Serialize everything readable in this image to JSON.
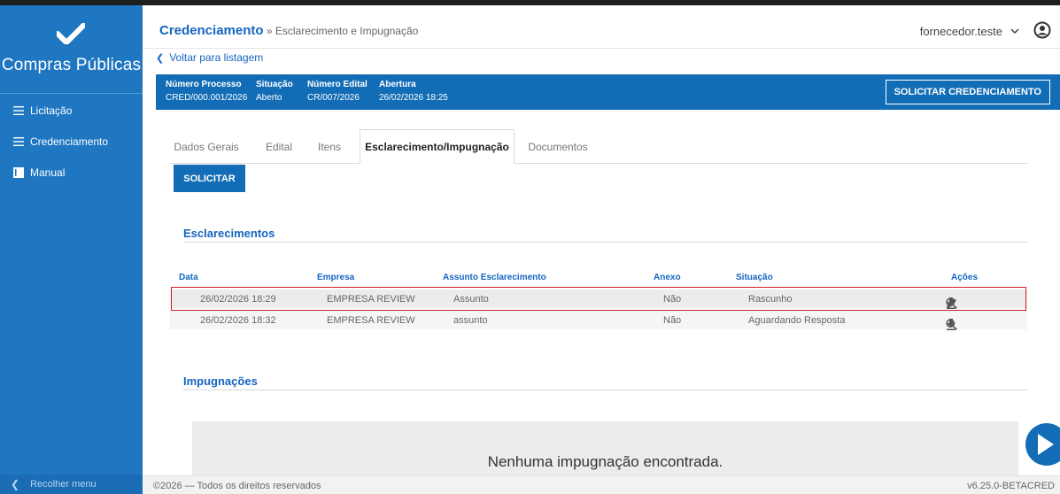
{
  "sidebar": {
    "brand": "Compras Públicas",
    "items": [
      {
        "label": "Licitação"
      },
      {
        "label": "Credenciamento"
      },
      {
        "label": "Manual"
      }
    ],
    "collapse_label": "Recolher menu"
  },
  "header": {
    "title": "Credenciamento",
    "breadcrumb": " » Esclarecimento e Impugnação",
    "user": "fornecedor.teste"
  },
  "back_link": "Voltar para listagem",
  "process": {
    "numero_processo_label": "Número Processo",
    "numero_processo": "CRED/000.001/2026",
    "situacao_label": "Situação",
    "situacao": "Aberto",
    "numero_edital_label": "Número Edital",
    "numero_edital": "CR/007/2026",
    "abertura_label": "Abertura",
    "abertura": "26/02/2026 18:25",
    "solicitar_credenciamento": "SOLICITAR CREDENCIAMENTO"
  },
  "tabs": [
    {
      "label": "Dados Gerais"
    },
    {
      "label": "Edital"
    },
    {
      "label": "Itens"
    },
    {
      "label": "Esclarecimento/Impugnação"
    },
    {
      "label": "Documentos"
    }
  ],
  "solicitar_button": "SOLICITAR",
  "esclarecimentos": {
    "title": "Esclarecimentos",
    "columns": [
      "Data",
      "Empresa",
      "Assunto Esclarecimento",
      "Anexo",
      "Situação",
      "Ações"
    ],
    "rows": [
      {
        "data": "26/02/2026 18:29",
        "empresa": "EMPRESA REVIEW",
        "assunto": "Assunto",
        "anexo": "Não",
        "situacao": "Rascunho"
      },
      {
        "data": "26/02/2026 18:32",
        "empresa": "EMPRESA REVIEW",
        "assunto": "assunto",
        "anexo": "Não",
        "situacao": "Aguardando Resposta"
      }
    ]
  },
  "impugnacoes": {
    "title": "Impugnações",
    "empty_message": "Nenhuma impugnação encontrada."
  },
  "footer": {
    "copyright": "©2026 — Todos os direitos reservados",
    "version": "v6.25.0-BETACRED"
  },
  "colors": {
    "primary": "#136db6",
    "sidebar": "#1f77c2",
    "link": "#1565c0",
    "highlight": "#d0212a"
  }
}
